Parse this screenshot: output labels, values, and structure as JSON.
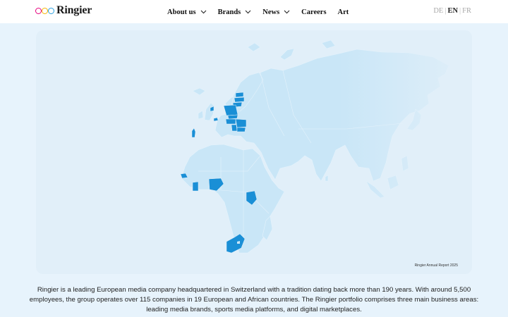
{
  "header": {
    "logo": {
      "wordmark": "Ringier",
      "ring_colors": [
        "#e6007e",
        "#f6b400",
        "#2aa0e0"
      ]
    },
    "nav": [
      {
        "label": "About us",
        "has_dropdown": true
      },
      {
        "label": "Brands",
        "has_dropdown": true
      },
      {
        "label": "News",
        "has_dropdown": true
      },
      {
        "label": "Careers",
        "has_dropdown": false
      },
      {
        "label": "Art",
        "has_dropdown": false
      }
    ],
    "languages": [
      {
        "code": "DE",
        "active": false
      },
      {
        "code": "EN",
        "active": true
      },
      {
        "code": "FR",
        "active": false
      }
    ]
  },
  "map": {
    "credit": "Ringier Annual Report 2025",
    "colors": {
      "land": "#c9e6f7",
      "highlight": "#1a8fd6",
      "background": "#e1eff9"
    },
    "highlighted_regions": [
      "Switzerland",
      "Netherlands",
      "Portugal",
      "Estonia",
      "Latvia",
      "Lithuania",
      "Poland",
      "Slovakia",
      "Hungary",
      "Romania",
      "Serbia",
      "Bulgaria",
      "Senegal",
      "Ghana",
      "Nigeria",
      "Kenya",
      "South Africa"
    ]
  },
  "intro": {
    "text": "Ringier is a leading European media company headquartered in Switzerland with a tradition dating back more than 190 years. With around 5,500 employees, the group operates over 115 companies in 19 European and African countries. The Ringier portfolio comprises three main business areas: leading media brands, sports media platforms, and digital marketplaces."
  },
  "icons": {
    "dropdown": "chevron-down-icon"
  }
}
